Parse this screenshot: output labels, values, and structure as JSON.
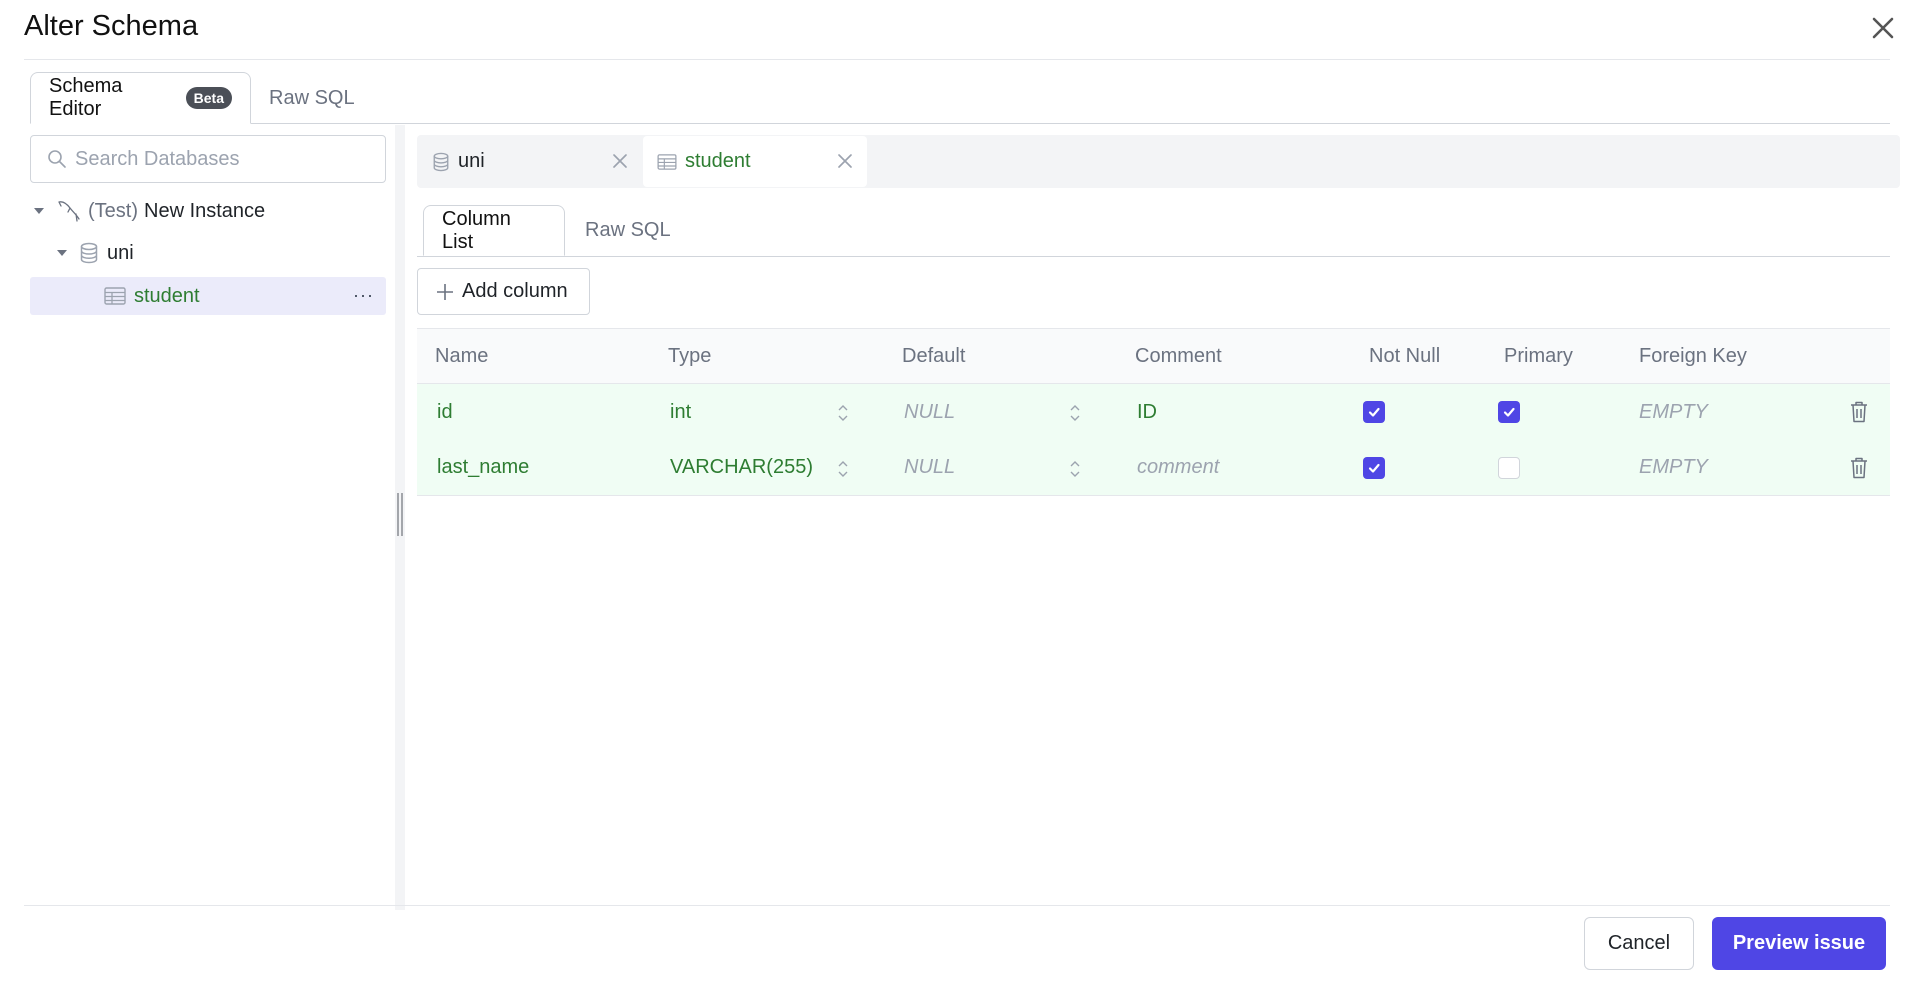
{
  "dialog": {
    "title": "Alter Schema",
    "close_icon": "close-icon"
  },
  "top_tabs": [
    {
      "label": "Schema Editor",
      "badge": "Beta",
      "active": true
    },
    {
      "label": "Raw SQL",
      "active": false
    }
  ],
  "sidebar": {
    "search_placeholder": "Search Databases",
    "search_value": "",
    "tree": {
      "instance": {
        "env": "(Test)",
        "name": "New Instance",
        "icon": "mysql-dolphin-icon",
        "expanded": true
      },
      "database": {
        "name": "uni",
        "icon": "database-icon",
        "expanded": true
      },
      "table": {
        "name": "student",
        "icon": "table-icon",
        "selected": true,
        "more_label": "···"
      }
    }
  },
  "object_tabs": [
    {
      "label": "uni",
      "icon": "database-icon",
      "active": false
    },
    {
      "label": "student",
      "icon": "table-icon",
      "active": true
    }
  ],
  "inner_tabs": [
    {
      "label": "Column List",
      "active": true
    },
    {
      "label": "Raw SQL",
      "active": false
    }
  ],
  "add_column_label": "Add column",
  "table": {
    "headers": [
      "Name",
      "Type",
      "Default",
      "Comment",
      "Not Null",
      "Primary",
      "Foreign Key"
    ],
    "rows": [
      {
        "name": "id",
        "type": "int",
        "default": "NULL",
        "default_is_placeholder": true,
        "comment": "ID",
        "comment_is_placeholder": false,
        "not_null": true,
        "primary": true,
        "foreign_key": "EMPTY"
      },
      {
        "name": "last_name",
        "type": "VARCHAR(255)",
        "default": "NULL",
        "default_is_placeholder": true,
        "comment": "comment",
        "comment_is_placeholder": true,
        "not_null": true,
        "primary": false,
        "foreign_key": "EMPTY"
      }
    ]
  },
  "footer": {
    "cancel_label": "Cancel",
    "preview_label": "Preview issue"
  },
  "colors": {
    "accent": "#4f46e5",
    "changed_row_bg": "#f0fdf4",
    "changed_text": "#2e7d32",
    "selected_tree_bg": "#ebebfa"
  }
}
